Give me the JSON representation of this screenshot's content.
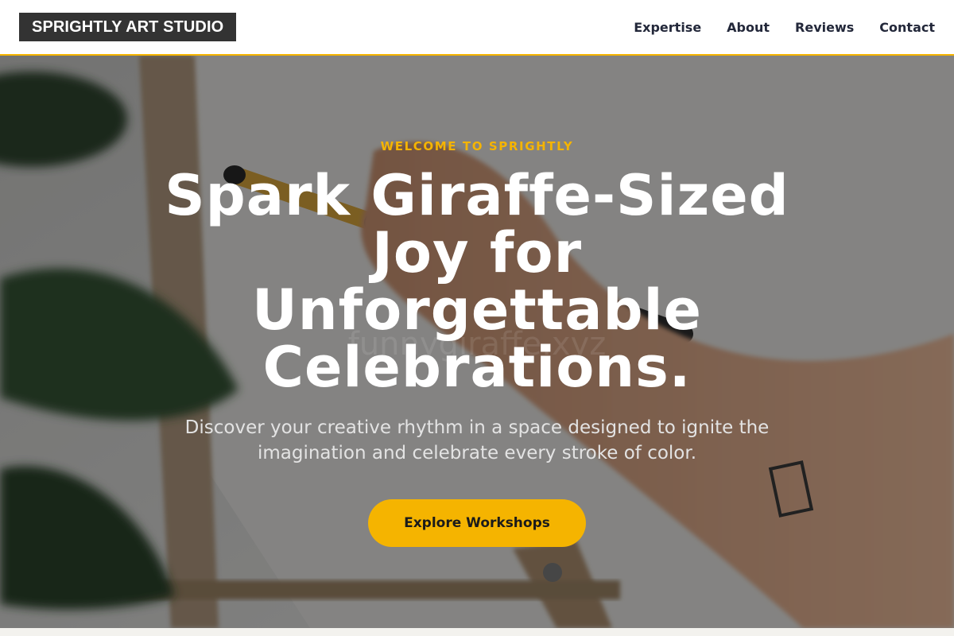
{
  "header": {
    "brand": "SPRIGHTLY ART STUDIO",
    "nav": [
      "Expertise",
      "About",
      "Reviews",
      "Contact"
    ]
  },
  "hero": {
    "eyebrow": "WELCOME TO SPRIGHTLY",
    "headline_lines": [
      "Spark Giraffe-Sized",
      "Joy for",
      "Unforgettable",
      "Celebrations."
    ],
    "subtext": "Discover your creative rhythm in a space designed to ignite the imagination and celebrate every stroke of color.",
    "cta_label": "Explore Workshops",
    "watermark": "funnygiraffe.xyz"
  },
  "colors": {
    "accent": "#f5b400",
    "logo_bg": "#333333",
    "nav_text": "#23283a"
  }
}
